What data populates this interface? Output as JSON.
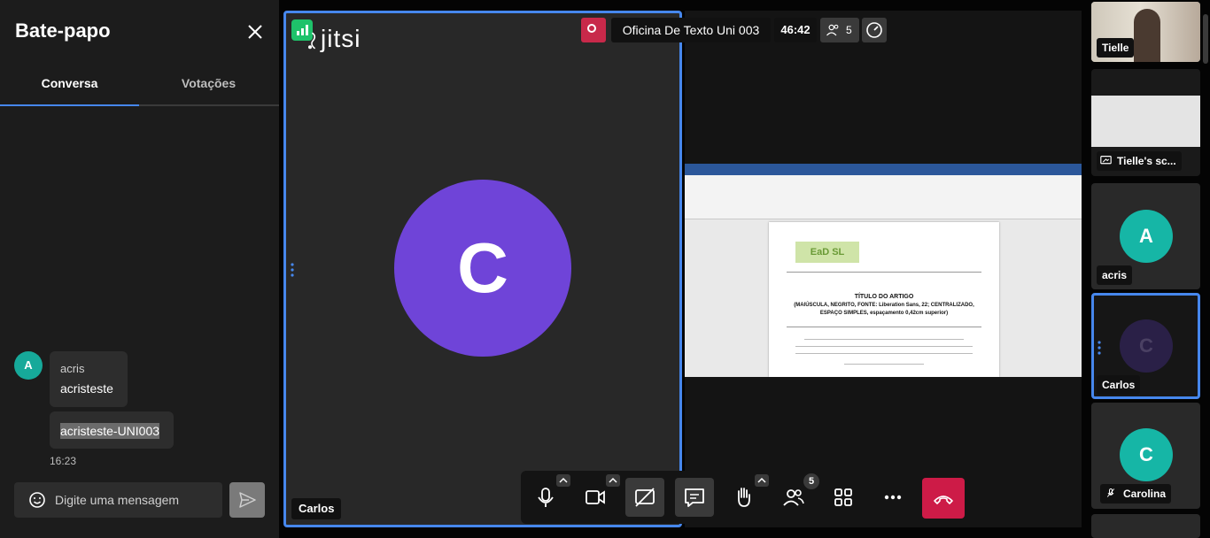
{
  "chat": {
    "title": "Bate-papo",
    "tabs": [
      {
        "label": "Conversa",
        "active": true
      },
      {
        "label": "Votações",
        "active": false
      }
    ],
    "messages": [
      {
        "avatar_letter": "A",
        "sender": "acris",
        "lines": [
          "acristeste",
          "acristeste-UNI003"
        ],
        "time": "16:23"
      }
    ],
    "input_placeholder": "Digite uma mensagem"
  },
  "meeting": {
    "title": "Oficina De Texto Uni 003",
    "duration": "46:42",
    "participant_count": "5",
    "logo_text": "jitsi"
  },
  "stage": {
    "avatar_letter": "C",
    "participant_name": "Carlos"
  },
  "shared_doc": {
    "logo": "EaD SL",
    "heading": "TÍTULO DO ARTIGO",
    "subheading": "(MAIÚSCULA, NEGRITO, FONTE: Liberation Sans, 22; CENTRALIZADO, ESPAÇO SIMPLES, espaçamento 0,42cm superior)"
  },
  "toolbar": {
    "participants_badge": "5"
  },
  "filmstrip": [
    {
      "name": "Tielle",
      "type": "video"
    },
    {
      "name": "Tielle's sc...",
      "type": "screen"
    },
    {
      "name": "acris",
      "avatar_letter": "A",
      "avatar_color": "#16b6a6"
    },
    {
      "name": "Carlos",
      "avatar_letter": "C",
      "avatar_color": "#2a2047",
      "active": true
    },
    {
      "name": "Carolina",
      "avatar_letter": "C",
      "avatar_color": "#16b6a6",
      "muted": true
    }
  ],
  "colors": {
    "accent": "#4687ed",
    "record": "#c8294a",
    "hangup": "#cd1b47",
    "stage_avatar": "#6f44d8",
    "teal_avatar": "#16b6a6"
  }
}
